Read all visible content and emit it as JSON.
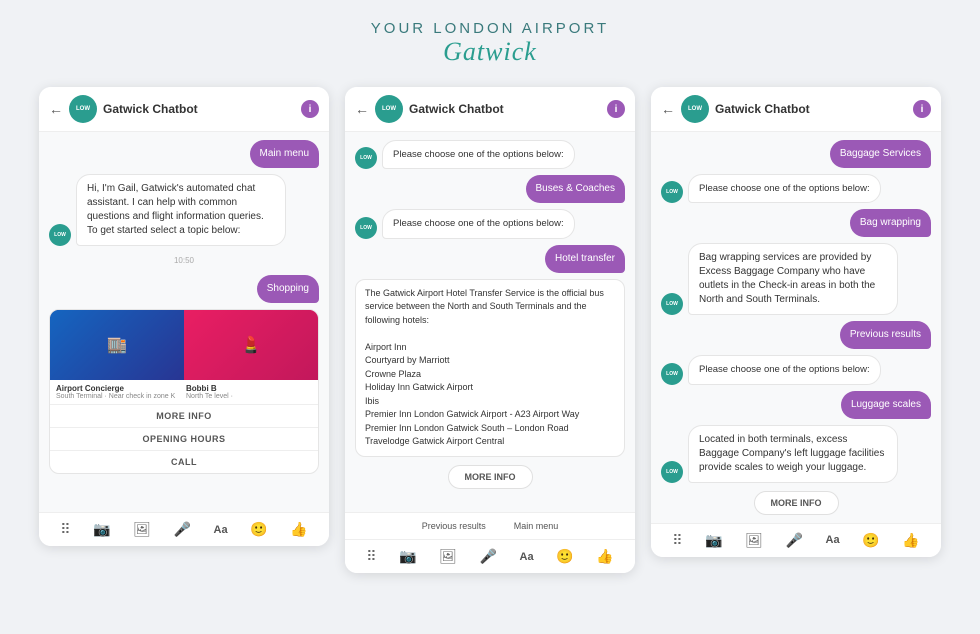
{
  "header": {
    "line1": "YOUR LONDON AIRPORT",
    "line2": "Gatwick"
  },
  "phones": [
    {
      "id": "phone1",
      "header": {
        "back": "←",
        "avatar_label": "LOW",
        "title": "Gatwick Chatbot",
        "info": "i"
      },
      "messages": [
        {
          "type": "user",
          "text": "Main menu"
        },
        {
          "type": "bot",
          "text": "Hi, I'm Gail, Gatwick's automated chat assistant. I can help with common questions and flight information queries. To get started select a topic below:"
        },
        {
          "type": "timestamp",
          "text": "10:50"
        },
        {
          "type": "user",
          "text": "Shopping"
        },
        {
          "type": "card",
          "title1": "Airport Concierge",
          "sub1": "South Terminal · Near check in zone K",
          "title2": "Bobbi B",
          "sub2": "North Te level ·"
        }
      ],
      "card_actions": [
        "MORE INFO",
        "OPENING HOURS",
        "CALL"
      ],
      "bottom_icons": [
        "⠿",
        "📷",
        "🖼",
        "🎤",
        "Aa",
        "🙂",
        "👍"
      ]
    },
    {
      "id": "phone2",
      "header": {
        "back": "←",
        "avatar_label": "LOW",
        "title": "Gatwick Chatbot",
        "info": "i"
      },
      "messages": [
        {
          "type": "bot_choose",
          "text": "Please choose one of the options below:"
        },
        {
          "type": "user",
          "text": "Buses & Coaches"
        },
        {
          "type": "bot_choose",
          "text": "Please choose one of the options below:"
        },
        {
          "type": "user",
          "text": "Hotel transfer"
        },
        {
          "type": "hotel_info",
          "text": "The Gatwick Airport Hotel Transfer Service is the official bus service between the North and South Terminals and the following hotels:\n\nAirport Inn\nCourtyard by Marriott\nCrowne Plaza\nHoliday Inn Gatwick Airport\nIbis\nPremier Inn London Gatwick Airport - A23 Airport Way\nPremier Inn London Gatwick South – London Road\nTravelodge Gatwick Airport Central"
        }
      ],
      "more_info": "MORE INFO",
      "footer_buttons": [
        "Previous results",
        "Main menu"
      ],
      "bottom_icons": [
        "⠿",
        "📷",
        "🖼",
        "🎤",
        "Aa",
        "🙂",
        "👍"
      ]
    },
    {
      "id": "phone3",
      "header": {
        "back": "←",
        "avatar_label": "LOW",
        "title": "Gatwick Chatbot",
        "info": "i"
      },
      "messages": [
        {
          "type": "user",
          "text": "Baggage Services"
        },
        {
          "type": "bot_choose",
          "text": "Please choose one of the options below:"
        },
        {
          "type": "user",
          "text": "Bag wrapping"
        },
        {
          "type": "bot",
          "text": "Bag wrapping services are provided by Excess Baggage Company who have outlets in the Check-in areas in both the North and South Terminals."
        },
        {
          "type": "user",
          "text": "Previous results"
        },
        {
          "type": "bot_choose",
          "text": "Please choose one of the options below:"
        },
        {
          "type": "user",
          "text": "Luggage scales"
        },
        {
          "type": "bot",
          "text": "Located in both terminals, excess Baggage Company's left luggage facilities provide scales to weigh your luggage."
        }
      ],
      "more_info": "MORE INFO",
      "bottom_icons": [
        "⠿",
        "📷",
        "🖼",
        "🎤",
        "Aa",
        "🙂",
        "👍"
      ]
    }
  ]
}
